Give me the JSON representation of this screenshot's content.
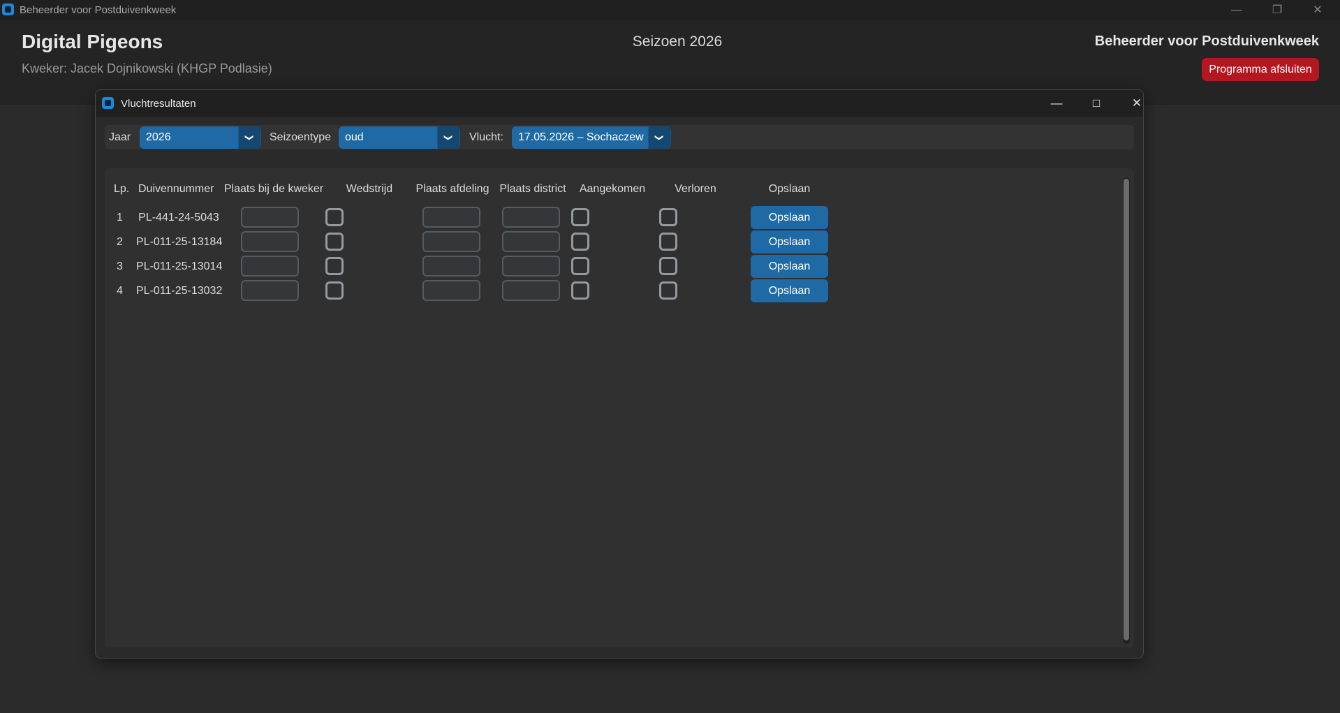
{
  "os_window": {
    "title": "Beheerder voor Postduivenkweek",
    "controls": [
      "minimize-icon",
      "restore-icon",
      "close-icon"
    ]
  },
  "header": {
    "app_title": "Digital Pigeons",
    "breeder": "Kweker: Jacek Dojnikowski (KHGP Podlasie)",
    "season": "Seizoen 2026",
    "app_name": "Beheerder voor Postduivenkweek",
    "quit_button": "Programma afsluiten"
  },
  "dialog": {
    "title": "Vluchtresultaten",
    "filters": {
      "year_label": "Jaar",
      "year_value": "2026",
      "season_type_label": "Seizoentype",
      "season_type_value": "oud",
      "flight_label": "Vlucht:",
      "flight_value": "17.05.2026 – Sochaczew"
    },
    "table": {
      "headers": [
        "Lp.",
        "Duivennummer",
        "Plaats bij de kweker",
        "Wedstrijd",
        "Plaats afdeling",
        "Plaats district",
        "Aangekomen",
        "Verloren",
        "Opslaan"
      ],
      "rows": [
        {
          "lp": "1",
          "ring": "PL-441-24-5043",
          "place_breeder": "",
          "competition": false,
          "place_section": "",
          "place_district": "",
          "arrived": false,
          "lost": false,
          "save_label": "Opslaan"
        },
        {
          "lp": "2",
          "ring": "PL-011-25-13184",
          "place_breeder": "",
          "competition": false,
          "place_section": "",
          "place_district": "",
          "arrived": false,
          "lost": false,
          "save_label": "Opslaan"
        },
        {
          "lp": "3",
          "ring": "PL-011-25-13014",
          "place_breeder": "",
          "competition": false,
          "place_section": "",
          "place_district": "",
          "arrived": false,
          "lost": false,
          "save_label": "Opslaan"
        },
        {
          "lp": "4",
          "ring": "PL-011-25-13032",
          "place_breeder": "",
          "competition": false,
          "place_section": "",
          "place_district": "",
          "arrived": false,
          "lost": false,
          "save_label": "Opslaan"
        }
      ]
    }
  },
  "colors": {
    "accent": "#1f6aa5",
    "accent_dark": "#144870",
    "danger": "#b3171f",
    "background": "#2b2b2b"
  }
}
